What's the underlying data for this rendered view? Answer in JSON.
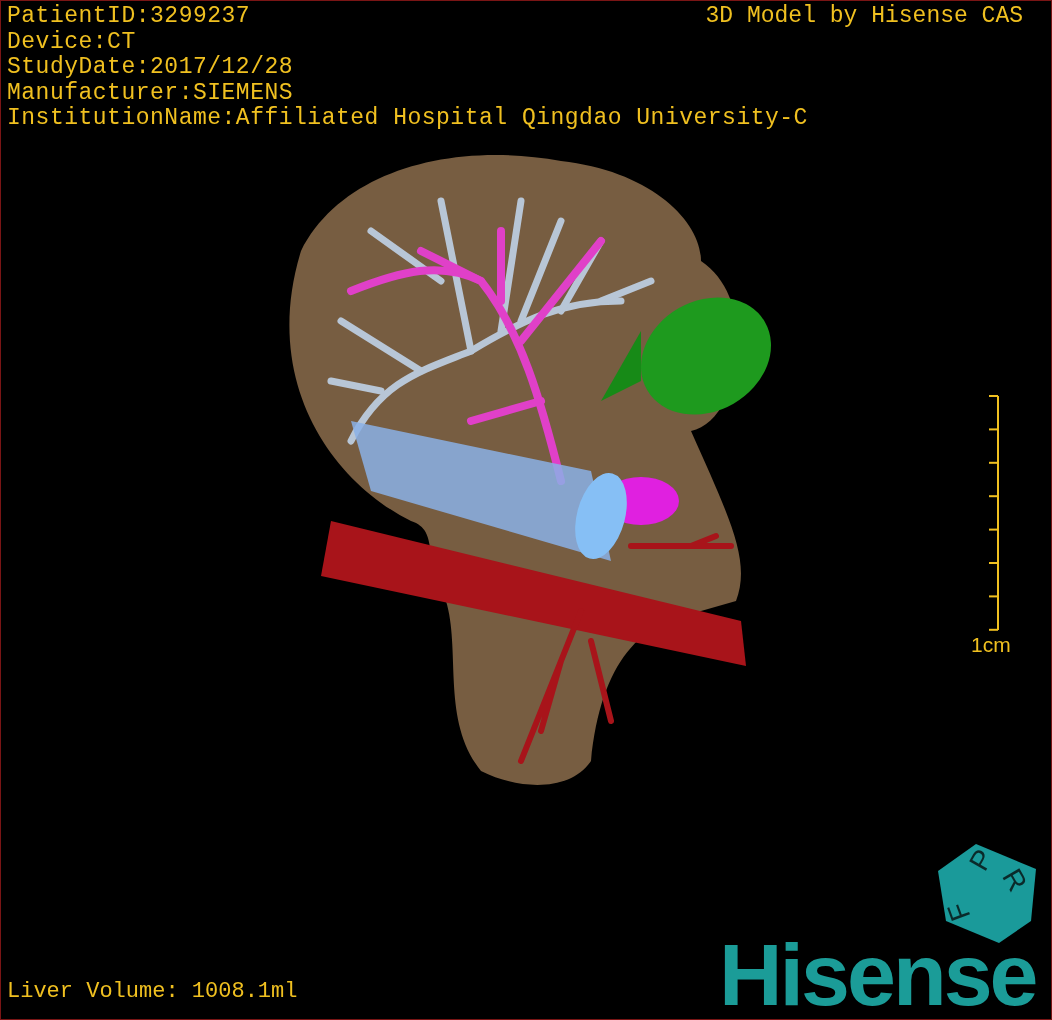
{
  "info_lines": [
    "PatientID:3299237",
    "Device:CT",
    "StudyDate:2017/12/28",
    "Manufacturer:SIEMENS",
    "InstitutionName:Affiliated Hospital Qingdao University-C"
  ],
  "title": "3D Model by Hisense CAS",
  "scale_bar": {
    "label": "1cm"
  },
  "orientation_cube": {
    "labels": [
      "P",
      "R",
      "F"
    ]
  },
  "logo": "Hisense",
  "liver_volume": "Liver Volume: 1008.1ml"
}
